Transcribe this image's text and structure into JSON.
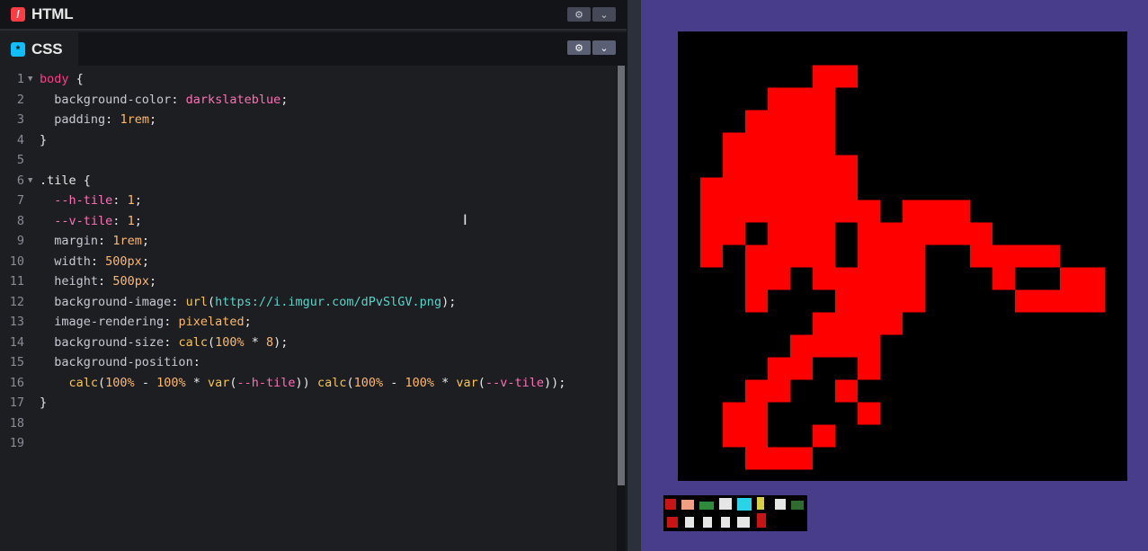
{
  "panels": {
    "html": {
      "label": "HTML",
      "icon": "html-icon"
    },
    "css": {
      "label": "CSS",
      "icon": "css-icon"
    }
  },
  "header_buttons": {
    "settings_icon": "gear-icon",
    "collapse_icon": "chevron-down-icon"
  },
  "editor": {
    "line_numbers": [
      "1",
      "2",
      "3",
      "4",
      "5",
      "6",
      "7",
      "8",
      "9",
      "10",
      "11",
      "12",
      "13",
      "14",
      "15",
      "16",
      "17",
      "18",
      "19"
    ]
  },
  "preview": {
    "background": "#483d8b",
    "tile_color": "#ff0000",
    "tile_background": "#000000"
  },
  "colors": {
    "editor_bg": "#1d1e22",
    "header_bg": "#131417",
    "html_badge": "#ff3c41",
    "css_badge": "#0ebeff"
  }
}
